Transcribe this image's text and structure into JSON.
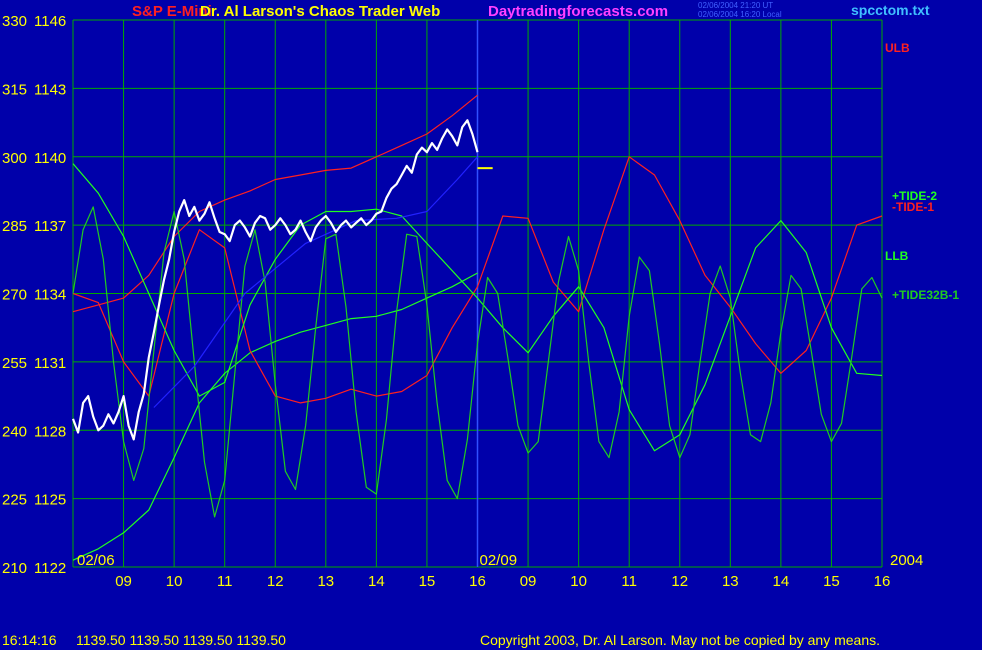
{
  "header": {
    "instrument": "S&P E-Mini",
    "site_title": "Dr. Al Larson's Chaos Trader Web",
    "site_url": "Daytradingforecasts.com",
    "timestamp_ut": "02/06/2004 21:20 UT",
    "timestamp_local": "02/06/2004 16:20 Local",
    "file_name": "spcctom.txt"
  },
  "footer": {
    "status_time": "16:14:16",
    "status_prices": "1139.50 1139.50 1139.50 1139.50",
    "copyright": "Copyright 2003, Dr. Al Larson. May not be copied by any means."
  },
  "colors": {
    "background": "#0000aa",
    "grid": "#00aa00",
    "price_text": "#ffff00",
    "ulb": "#ff2020",
    "llb": "#20ff20",
    "tide1": "#ff2020",
    "tide2": "#20ff20",
    "tide32b": "#20cc20",
    "price": "#ffffff",
    "url": "#ff40ff",
    "file": "#40c0ff"
  },
  "chart_data": {
    "type": "line",
    "left_axis_labels": [
      "330",
      "315",
      "300",
      "285",
      "270",
      "255",
      "240",
      "225",
      "210"
    ],
    "y_ticks": [
      1146,
      1143,
      1140,
      1137,
      1134,
      1131,
      1128,
      1125,
      1122
    ],
    "ylim": [
      1122,
      1146
    ],
    "date_labels": [
      "02/06",
      "02/09"
    ],
    "year_label": "2004",
    "x_ticks": [
      "09",
      "10",
      "11",
      "12",
      "13",
      "14",
      "15",
      "16",
      "09",
      "10",
      "11",
      "12",
      "13",
      "14",
      "15",
      "16"
    ],
    "series": [
      {
        "name": "ULB",
        "color": "#ff2020",
        "x": [
          0,
          0.5,
          1,
          1.5,
          2,
          2.5,
          3,
          3.5,
          4,
          4.5,
          5,
          5.5,
          6,
          6.5,
          7,
          7.5,
          8
        ],
        "y": [
          1133.2,
          1133.5,
          1133.8,
          1134.8,
          1136.5,
          1137.6,
          1138.1,
          1138.5,
          1139.0,
          1139.2,
          1139.4,
          1139.5,
          1140.0,
          1140.5,
          1141.0,
          1141.8,
          1142.7
        ]
      },
      {
        "name": "LLB",
        "color": "#20ff20",
        "x": [
          0,
          0.5,
          1,
          1.5,
          2,
          2.5,
          3,
          3.5,
          4,
          4.5,
          5,
          5.5,
          6,
          6.5,
          7,
          7.5,
          8
        ],
        "y": [
          1122.3,
          1122.8,
          1123.5,
          1124.5,
          1126.8,
          1129.2,
          1130.5,
          1131.4,
          1131.9,
          1132.3,
          1132.6,
          1132.9,
          1133.0,
          1133.3,
          1133.8,
          1134.3,
          1134.9
        ]
      },
      {
        "name": "-TIDE-1",
        "color": "#ff2020",
        "x": [
          0,
          0.5,
          1,
          1.5,
          2,
          2.5,
          3,
          3.5,
          4,
          4.5,
          5,
          5.5,
          6,
          6.5,
          7,
          7.5,
          8,
          8.5,
          9,
          9.5,
          10,
          10.5,
          11,
          11.5,
          12,
          12.5,
          13,
          13.5,
          14,
          14.5,
          15,
          15.5,
          16
        ],
        "y": [
          1134,
          1133.6,
          1131,
          1129.5,
          1134,
          1136.8,
          1136,
          1131.5,
          1129.5,
          1129.2,
          1129.4,
          1129.8,
          1129.5,
          1129.7,
          1130.4,
          1132.5,
          1134.3,
          1137.4,
          1137.3,
          1134.5,
          1133.2,
          1136.8,
          1140.0,
          1139.2,
          1137.2,
          1134.8,
          1133.4,
          1131.8,
          1130.5,
          1131.5,
          1133.8,
          1137.0,
          1137.4
        ]
      },
      {
        "name": "+TIDE-2",
        "color": "#20ff20",
        "x": [
          0,
          0.5,
          1,
          1.5,
          2,
          2.5,
          3,
          3.5,
          4,
          4.5,
          5,
          5.5,
          6,
          6.5,
          7,
          7.5,
          8,
          8.5,
          9,
          9.5,
          10,
          10.5,
          11,
          11.5,
          12,
          12.5,
          13,
          13.5,
          14,
          14.5,
          15,
          15.5,
          16
        ],
        "y": [
          1139.7,
          1138.4,
          1136.5,
          1134,
          1131.5,
          1129.5,
          1130.1,
          1133.5,
          1135.5,
          1137.0,
          1137.6,
          1137.6,
          1137.7,
          1137.4,
          1136.2,
          1135.0,
          1133.8,
          1132.5,
          1131.4,
          1133.0,
          1134.3,
          1132.5,
          1128.9,
          1127.1,
          1127.8,
          1130.0,
          1133.0,
          1136.0,
          1137.2,
          1135.8,
          1132.5,
          1130.5,
          1130.4
        ]
      },
      {
        "name": "+TIDE32B-1",
        "color": "#20cc20",
        "x": [
          0,
          0.2,
          0.4,
          0.6,
          0.8,
          1.0,
          1.2,
          1.4,
          1.6,
          1.8,
          2.0,
          2.2,
          2.4,
          2.6,
          2.8,
          3.0,
          3.2,
          3.4,
          3.6,
          3.8,
          4.0,
          4.2,
          4.4,
          4.6,
          4.8,
          5.0,
          5.2,
          5.4,
          5.6,
          5.8,
          6.0,
          6.2,
          6.4,
          6.6,
          6.8,
          7.0,
          7.2,
          7.4,
          7.6,
          7.8,
          8.0,
          8.2,
          8.4,
          8.6,
          8.8,
          9.0,
          9.2,
          9.4,
          9.6,
          9.8,
          10.0,
          10.2,
          10.4,
          10.6,
          10.8,
          11.0,
          11.2,
          11.4,
          11.6,
          11.8,
          12.0,
          12.2,
          12.4,
          12.6,
          12.8,
          13.0,
          13.2,
          13.4,
          13.6,
          13.8,
          14.0,
          14.2,
          14.4,
          14.6,
          14.8,
          15.0,
          15.2,
          15.4,
          15.6,
          15.8,
          16.0
        ],
        "y": [
          1134,
          1136.8,
          1137.8,
          1135.5,
          1131,
          1127.5,
          1125.8,
          1127.2,
          1131.5,
          1135.8,
          1137.6,
          1135.5,
          1131,
          1126.6,
          1124.2,
          1125.8,
          1130.5,
          1135.2,
          1136.8,
          1134.5,
          1130,
          1126.2,
          1125.4,
          1128.2,
          1132.5,
          1136.4,
          1136.6,
          1133.4,
          1128.8,
          1125.5,
          1125.2,
          1128.5,
          1133.2,
          1136.6,
          1136.5,
          1133.5,
          1129.2,
          1125.8,
          1125.0,
          1127.6,
          1131.8,
          1134.7,
          1134.0,
          1131.2,
          1128.2,
          1127.0,
          1127.5,
          1131.0,
          1134.5,
          1136.5,
          1135.0,
          1131.0,
          1127.5,
          1126.8,
          1128.8,
          1133.0,
          1135.6,
          1135.0,
          1131.8,
          1128.2,
          1126.8,
          1127.8,
          1131.0,
          1134.0,
          1135.2,
          1133.8,
          1130.5,
          1127.8,
          1127.5,
          1129.2,
          1132.3,
          1134.8,
          1134.2,
          1131.5,
          1128.7,
          1127.5,
          1128.3,
          1131.2,
          1134.2,
          1134.7,
          1133.8
        ]
      },
      {
        "name": "",
        "color": "#2222ff",
        "x": [
          1.6,
          2.4,
          3.4,
          4.6,
          5.6,
          6.4,
          7.0,
          7.6,
          8.0
        ],
        "y": [
          1129.0,
          1130.8,
          1134.0,
          1136.2,
          1137.2,
          1137.3,
          1137.6,
          1139.0,
          1140.0
        ]
      },
      {
        "name": "",
        "color": "#ffffff",
        "x": [
          0,
          0.1,
          0.2,
          0.3,
          0.4,
          0.5,
          0.6,
          0.7,
          0.8,
          0.9,
          1.0,
          1.1,
          1.2,
          1.3,
          1.4,
          1.5,
          1.6,
          1.7,
          1.8,
          1.9,
          2.0,
          2.1,
          2.2,
          2.3,
          2.4,
          2.5,
          2.6,
          2.7,
          2.8,
          2.9,
          3.0,
          3.1,
          3.2,
          3.3,
          3.4,
          3.5,
          3.6,
          3.7,
          3.8,
          3.9,
          4.0,
          4.1,
          4.2,
          4.3,
          4.4,
          4.5,
          4.6,
          4.7,
          4.8,
          4.9,
          5.0,
          5.1,
          5.2,
          5.3,
          5.4,
          5.5,
          5.6,
          5.7,
          5.8,
          5.9,
          6.0,
          6.1,
          6.2,
          6.3,
          6.4,
          6.5,
          6.6,
          6.7,
          6.8,
          6.9,
          7.0,
          7.1,
          7.2,
          7.3,
          7.4,
          7.5,
          7.6,
          7.7,
          7.8,
          7.9,
          8.0
        ],
        "y": [
          1128.5,
          1127.9,
          1129.2,
          1129.5,
          1128.6,
          1128.0,
          1128.2,
          1128.7,
          1128.3,
          1128.8,
          1129.5,
          1128.2,
          1127.6,
          1128.8,
          1129.6,
          1131.2,
          1132.3,
          1133.5,
          1134.6,
          1135.5,
          1136.7,
          1137.6,
          1138.1,
          1137.4,
          1137.8,
          1137.2,
          1137.5,
          1138.0,
          1137.3,
          1136.7,
          1136.6,
          1136.3,
          1137.0,
          1137.2,
          1136.9,
          1136.5,
          1137.1,
          1137.4,
          1137.3,
          1136.8,
          1137.0,
          1137.3,
          1137.0,
          1136.6,
          1136.8,
          1137.2,
          1136.7,
          1136.3,
          1136.9,
          1137.2,
          1137.4,
          1137.1,
          1136.7,
          1137.0,
          1137.2,
          1136.9,
          1137.1,
          1137.3,
          1137.0,
          1137.2,
          1137.5,
          1137.6,
          1138.2,
          1138.6,
          1138.8,
          1139.2,
          1139.6,
          1139.3,
          1140.1,
          1140.4,
          1140.2,
          1140.6,
          1140.3,
          1140.8,
          1141.2,
          1140.9,
          1140.5,
          1141.3,
          1141.6,
          1141.0,
          1140.2
        ]
      }
    ],
    "last_price_marker": {
      "x": [
        8.0,
        8.3
      ],
      "y": [
        1139.5,
        1139.5
      ]
    }
  }
}
